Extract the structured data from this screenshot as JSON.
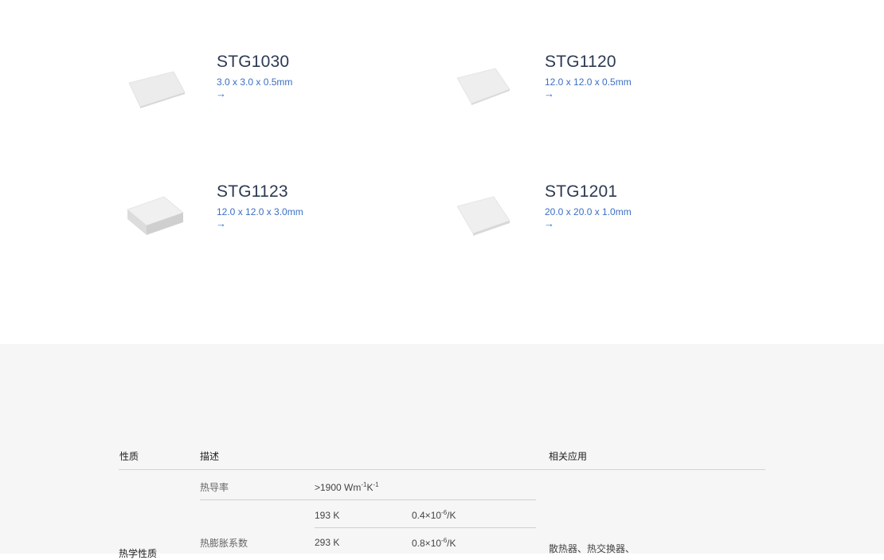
{
  "products": [
    {
      "name": "STG1030",
      "dims": "3.0 x 3.0 x 0.5mm",
      "arrow": "→"
    },
    {
      "name": "STG1120",
      "dims": "12.0 x 12.0 x 0.5mm",
      "arrow": "→"
    },
    {
      "name": "STG1123",
      "dims": "12.0 x 12.0 x 3.0mm",
      "arrow": "→"
    },
    {
      "name": "STG1201",
      "dims": "20.0 x 20.0 x 1.0mm",
      "arrow": "→"
    }
  ],
  "table": {
    "headers": {
      "property": "性质",
      "description": "描述",
      "applications": "相关应用"
    },
    "group_label": "热学性质",
    "thermal_conductivity": {
      "label": "热导率",
      "value_prefix": ">1900 Wm",
      "exp1": "-1",
      "unit2": "K",
      "exp2": "-1"
    },
    "thermal_expansion": {
      "label": "热膨胀系数",
      "rows": [
        {
          "temp": "193 K",
          "coef_base": "0.4×10",
          "coef_exp": "-6",
          "coef_unit": "/K"
        },
        {
          "temp": "293 K",
          "coef_base": "0.8×10",
          "coef_exp": "-6",
          "coef_unit": "/K"
        }
      ]
    },
    "applications_text": "散热器、热交换器、"
  },
  "colors": {
    "accent": "#3a6fc4",
    "title": "#2c3a52",
    "section_bg": "#f6f6f6"
  }
}
